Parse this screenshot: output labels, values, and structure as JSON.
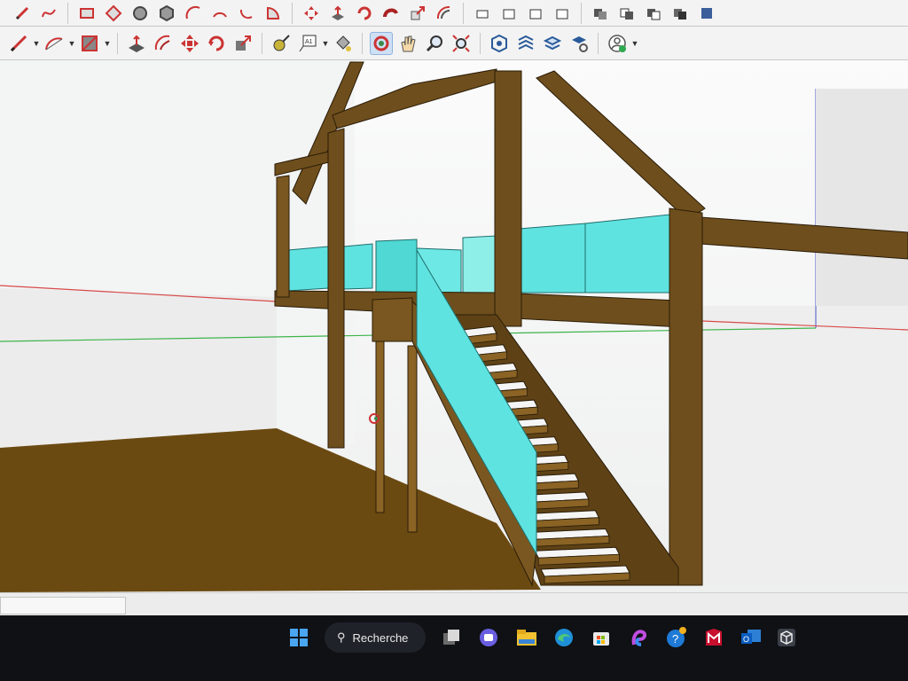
{
  "toolbar_top": {
    "icons": [
      "pencil-icon",
      "freehand-icon",
      "rectangle-icon",
      "rotated-rectangle-icon",
      "circle-icon",
      "polygon-icon",
      "arc-icon",
      "two-point-arc-icon",
      "three-point-arc-icon",
      "pie-icon",
      "move-icon",
      "push-pull-icon",
      "rotate-icon",
      "follow-me-icon",
      "scale-icon",
      "offset-icon",
      "eraser-icon",
      "paint-bucket-icon",
      "component-icon",
      "group-icon",
      "solid-union-icon",
      "solid-subtract-icon",
      "solid-trim-icon",
      "solid-split-icon",
      "solid-outer-shell-icon"
    ]
  },
  "toolbar_main": {
    "tools": [
      {
        "name": "line-tool-icon",
        "dropdown": true
      },
      {
        "name": "arc-tool-icon",
        "dropdown": true
      },
      {
        "name": "shape-tool-icon",
        "dropdown": true
      },
      {
        "name": "push-pull-tool-icon"
      },
      {
        "name": "offset-tool-icon"
      },
      {
        "name": "move-tool-icon"
      },
      {
        "name": "rotate-tool-icon"
      },
      {
        "name": "scale-tool-icon"
      },
      {
        "name": "tape-measure-icon"
      },
      {
        "name": "text-tool-icon",
        "dropdown": true
      },
      {
        "name": "paint-bucket-icon"
      },
      {
        "name": "orbit-tool-icon",
        "active": true
      },
      {
        "name": "pan-tool-icon"
      },
      {
        "name": "zoom-tool-icon"
      },
      {
        "name": "zoom-extents-icon"
      },
      {
        "name": "warehouse-icon"
      },
      {
        "name": "extension-warehouse-icon"
      },
      {
        "name": "layout-send-icon"
      },
      {
        "name": "extension-manager-icon"
      },
      {
        "name": "account-icon",
        "dropdown": true
      }
    ],
    "account_status_color": "#2fa84f"
  },
  "viewport": {
    "background_color": "#f1f2f2",
    "floor_color": "#6b4a12",
    "timber_color": "#6e4e1c",
    "glass_color": "#5fe3e0",
    "axis_colors": {
      "red": "#d84a4a",
      "green": "#3cb44a",
      "blue": "#4a55c8"
    }
  },
  "taskbar": {
    "search_label": "Recherche",
    "apps": [
      "windows-start-icon",
      "search-icon",
      "task-view-icon",
      "teams-chat-icon",
      "file-explorer-icon",
      "edge-browser-icon",
      "microsoft-store-icon",
      "copilot-icon",
      "get-help-icon",
      "mcafee-icon",
      "outlook-icon",
      "sketchup-icon"
    ]
  }
}
